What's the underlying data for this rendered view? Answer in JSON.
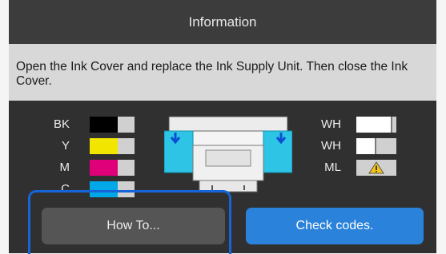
{
  "header": {
    "title": "Information"
  },
  "message": {
    "text": "Open the Ink Cover and replace the Ink Supply Unit. Then close the Ink Cover."
  },
  "inks_left": [
    {
      "label": "BK",
      "color": "#000000",
      "level": 0.6
    },
    {
      "label": "Y",
      "color": "#f2e600",
      "level": 0.6
    },
    {
      "label": "M",
      "color": "#e0007a",
      "level": 0.6
    },
    {
      "label": "C",
      "color": "#00a8e8",
      "level": 0.6
    }
  ],
  "inks_right": [
    {
      "label": "WH",
      "color": "#ffffff",
      "level": 0.9
    },
    {
      "label": "WH",
      "color": "#ffffff",
      "level": 0.5
    },
    {
      "label": "ML",
      "status": "warning",
      "icon": "warning-icon"
    }
  ],
  "colors": {
    "accent": "#2a82da",
    "focus": "#1565d8",
    "warning": "#f5c518"
  },
  "buttons": {
    "how_to": "How To...",
    "check_codes": "Check codes."
  }
}
